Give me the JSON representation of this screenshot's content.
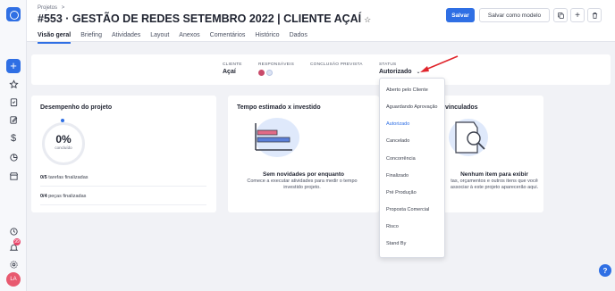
{
  "header": {
    "breadcrumb": "Projetos",
    "breadcrumb_sep": ">",
    "title": "#553 · GESTÃO DE REDES SETEMBRO 2022 | CLIENTE AÇAÍ",
    "star_icon": "☆",
    "save_label": "Salvar",
    "save_model_label": "Salvar como modelo",
    "tabs": [
      {
        "label": "Visão geral",
        "active": true
      },
      {
        "label": "Briefing"
      },
      {
        "label": "Atividades"
      },
      {
        "label": "Layout"
      },
      {
        "label": "Anexos"
      },
      {
        "label": "Comentários"
      },
      {
        "label": "Histórico"
      },
      {
        "label": "Dados"
      }
    ]
  },
  "rail": {
    "notif_count": "99",
    "avatar": "LA"
  },
  "info": {
    "client_label": "CLIENTE",
    "client_value": "Açaí",
    "resp_label": "RESPONSÁVEIS",
    "conclusion_label": "CONCLUSÃO PREVISTA",
    "status_label": "STATUS",
    "status_value": "Autorizado"
  },
  "performance": {
    "title": "Desempenho do projeto",
    "percent": "0%",
    "percent_sub": "concluído",
    "tasks_count": "0/5",
    "tasks_label": "tarefas finalizadas",
    "pieces_count": "0/4",
    "pieces_label": "peças finalizadas"
  },
  "time": {
    "title": "Tempo estimado x investido",
    "empty_title": "Sem novidades por enquanto",
    "empty_desc": "Comece a executar atividades para medir o tempo investido projeto."
  },
  "linked": {
    "title": "vinculados",
    "empty_title": "Nenhum item para exibir",
    "empty_desc": "tas, orçamentos e outros itens que você associar à este projeto aparecerão aqui."
  },
  "dropdown": {
    "options": [
      "Aberto pelo Cliente",
      "Aguardando Aprovação",
      "Autorizado",
      "Cancelado",
      "Concorrência",
      "Finalizado",
      "Pré Produção",
      "Proposta Comercial",
      "Risco",
      "Stand By"
    ],
    "selected": "Autorizado"
  },
  "colors": {
    "accent": "#2f6fe4",
    "arrow": "#e0242b",
    "illustration_bg": "#dfe9fb",
    "bar_pink": "#e26a86"
  },
  "help_label": "?"
}
